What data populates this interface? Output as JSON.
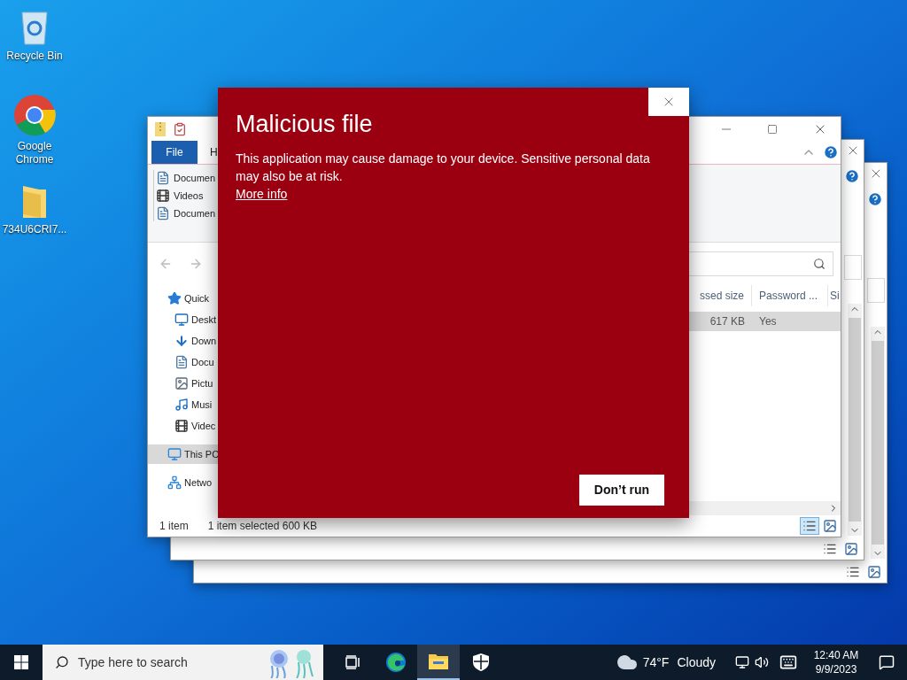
{
  "desktop_icons": [
    {
      "label": "Recycle Bin",
      "kind": "recycle"
    },
    {
      "label": "Google Chrome",
      "kind": "chrome"
    },
    {
      "label": "734U6CRI7...",
      "kind": "folder"
    }
  ],
  "explorer": {
    "ribbon_tabs": [
      {
        "label": "File",
        "selected": true
      },
      {
        "label": "H",
        "selected": false
      }
    ],
    "ribbon_items": [
      {
        "label": "Documen",
        "kind": "document"
      },
      {
        "label": "Videos",
        "kind": "video"
      },
      {
        "label": "Documen",
        "kind": "document"
      }
    ],
    "nav_tree": [
      {
        "label": "Quick",
        "kind": "star",
        "selected": false,
        "children": [
          {
            "label": "Deskt",
            "kind": "desktop",
            "selected": false
          },
          {
            "label": "Down",
            "kind": "download",
            "selected": false
          },
          {
            "label": "Docu",
            "kind": "document",
            "selected": false
          },
          {
            "label": "Pictu",
            "kind": "picture",
            "selected": false
          },
          {
            "label": "Musi",
            "kind": "music",
            "selected": false
          },
          {
            "label": "Videc",
            "kind": "video",
            "selected": false
          }
        ]
      },
      {
        "label": "This PC",
        "kind": "pc",
        "selected": true
      },
      {
        "label": "Netwo",
        "kind": "network",
        "selected": false
      }
    ],
    "columns": [
      "ssed size",
      "Password ...",
      "Si"
    ],
    "rows": [
      {
        "cells": [
          "617 KB",
          "Yes"
        ],
        "selected": true
      }
    ],
    "status_bar": [
      "1 item",
      "1 item selected 600 KB"
    ]
  },
  "dialog": {
    "title": "Malicious file",
    "message": "This application may cause damage to your device. Sensitive personal data may also be at risk.",
    "link": "More info",
    "button": "Don’t run"
  },
  "taskbar": {
    "search": {
      "placeholder": "Type here to search"
    },
    "apps": [
      {
        "kind": "taskview",
        "active": false
      },
      {
        "kind": "edge",
        "active": false
      },
      {
        "kind": "explorer",
        "active": true
      },
      {
        "kind": "shield",
        "active": false
      }
    ],
    "weather": {
      "temperature": "74°F",
      "condition": "Cloudy"
    },
    "time": "12:40 AM",
    "date": "9/9/2023"
  }
}
